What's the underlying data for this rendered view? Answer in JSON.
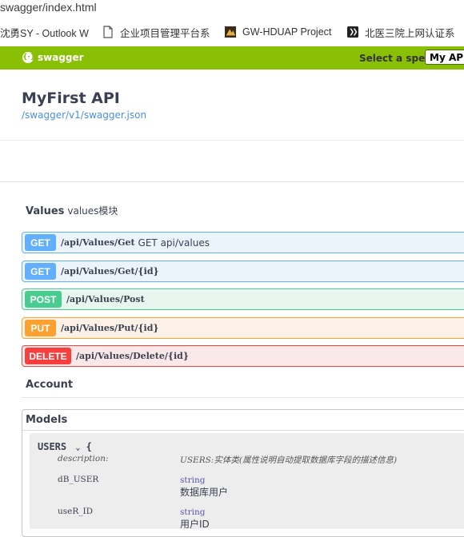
{
  "browser": {
    "url": "swagger/index.html",
    "bookmarks": [
      {
        "label": "沈勇SY - Outlook W",
        "icon": "outlook-icon"
      },
      {
        "label": "企业项目管理平台系",
        "icon": "page-icon"
      },
      {
        "label": "GW-HDUAP Project",
        "icon": "project-icon"
      },
      {
        "label": "北医三院上网认证系",
        "icon": "network-auth-icon"
      }
    ]
  },
  "topbar": {
    "logo_text": "swagger",
    "spec_label": "Select a spec",
    "spec_value": "My API",
    "accent": "#89bf04"
  },
  "info": {
    "title": "MyFirst API",
    "url": "/swagger/v1/swagger.json"
  },
  "tag": {
    "name": "Values",
    "description": "values模块"
  },
  "operations": [
    {
      "method": "GET",
      "path": "/api/Values/Get",
      "summary": "GET api/values",
      "color": "#61affe",
      "bg": "#ebf3fb"
    },
    {
      "method": "GET",
      "path": "/api/Values/Get/{id}",
      "summary": "",
      "color": "#61affe",
      "bg": "#ebf3fb"
    },
    {
      "method": "POST",
      "path": "/api/Values/Post",
      "summary": "",
      "color": "#49cc90",
      "bg": "#e8f6f0"
    },
    {
      "method": "PUT",
      "path": "/api/Values/Put/{id}",
      "summary": "",
      "color": "#fca130",
      "bg": "#fbf1e6"
    },
    {
      "method": "DELETE",
      "path": "/api/Values/Delete/{id}",
      "summary": "",
      "color": "#f93e3e",
      "bg": "#fae7e7"
    }
  ],
  "account": {
    "name": "Account"
  },
  "models": {
    "title": "Models",
    "model_name": "USERS",
    "brace": "{",
    "description_key": "description:",
    "description_value": "USERS:实体类(属性说明自动提取数据库字段的描述信息)",
    "fields": [
      {
        "name": "dB_USER",
        "type": "string",
        "desc": "数据库用户"
      },
      {
        "name": "useR_ID",
        "type": "string",
        "desc": "用户ID"
      }
    ]
  }
}
